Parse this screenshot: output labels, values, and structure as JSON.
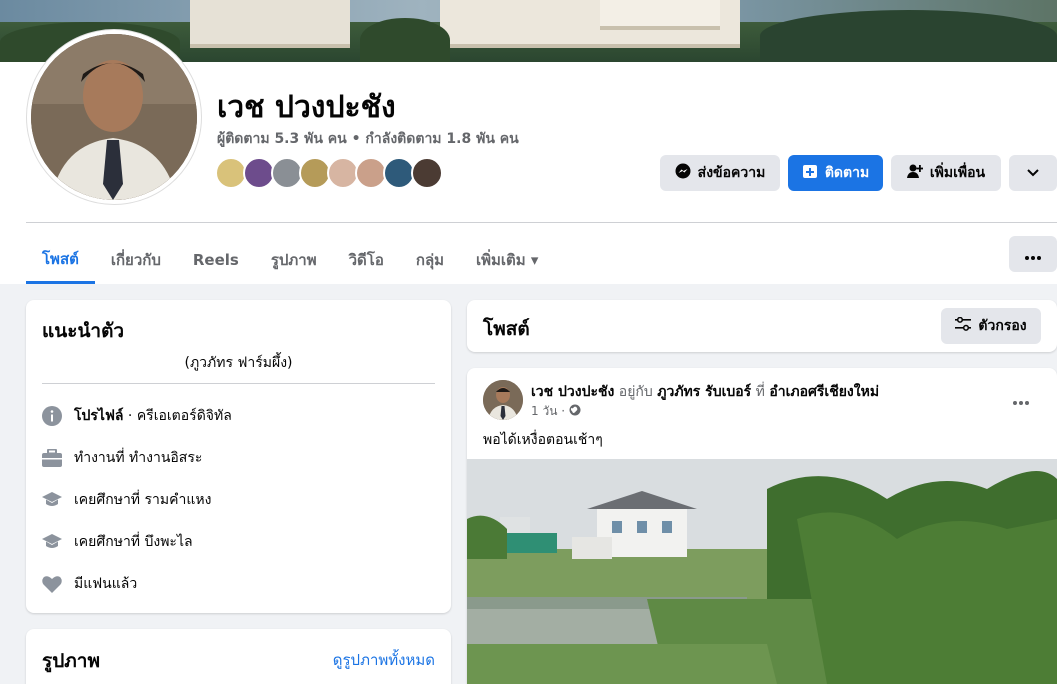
{
  "profile": {
    "name": "เวช ปวงปะชัง",
    "stats": "ผู้ติดตาม 5.3 พัน คน • กำลังติดตาม 1.8 พัน คน",
    "friend_avatar_colors": [
      "#d9c27a",
      "#6d4c8c",
      "#8a8f95",
      "#b59b59",
      "#d7b5a2",
      "#caa08a",
      "#2e5a7a",
      "#4b3b33"
    ]
  },
  "actions": {
    "message": "ส่งข้อความ",
    "follow": "ติดตาม",
    "add_friend": "เพิ่มเพื่อน"
  },
  "tabs": [
    {
      "label": "โพสต์"
    },
    {
      "label": "เกี่ยวกับ"
    },
    {
      "label": "Reels"
    },
    {
      "label": "รูปภาพ"
    },
    {
      "label": "วิดีโอ"
    },
    {
      "label": "กลุ่ม"
    },
    {
      "label": "เพิ่มเติม ▾"
    }
  ],
  "intro": {
    "title": "แนะนำตัว",
    "bio": "(ภูวภัทร ฟาร์มผึ้ง)",
    "profile_label": "โปรไฟล์",
    "profile_value": " · ครีเอเตอร์ดิจิทัล",
    "work": "ทำงานที่ ทำงานอิสระ",
    "edu1": "เคยศึกษาที่ รามคำแหง",
    "edu2": "เคยศึกษาที่ บึงพะไล",
    "relationship": "มีแฟนแล้ว"
  },
  "photos": {
    "title": "รูปภาพ",
    "see_all": "ดูรูปภาพทั้งหมด"
  },
  "posts_header": {
    "title": "โพสต์",
    "filter": "ตัวกรอง"
  },
  "post": {
    "author": "เวช ปวงปะชัง",
    "with_text": " อยู่กับ ",
    "tagged": "ภูวภัทร รับเบอร์",
    "at_text": " ที่ ",
    "location": "อำเภอศรีเชียงใหม่",
    "time": "1 วัน ·",
    "text": "พอได้เหงื่อตอนเช้าๆ"
  },
  "colors": {
    "accent": "#1b74e4",
    "secondary_text": "#65676b",
    "button_gray": "#e4e6eb"
  }
}
